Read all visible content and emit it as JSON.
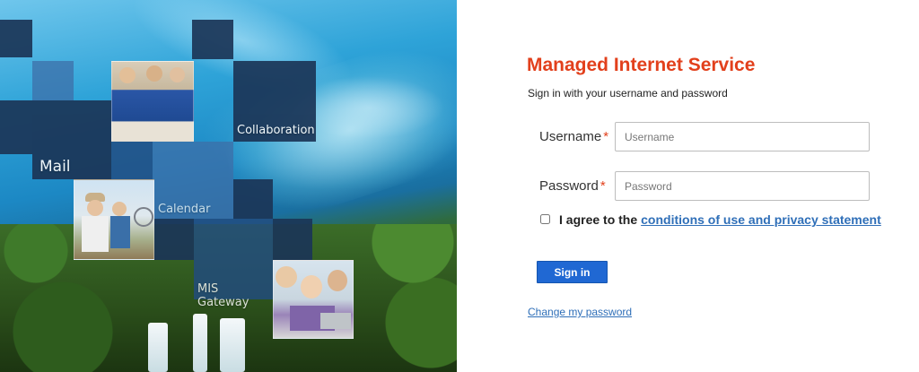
{
  "hero": {
    "tiles": {
      "collaboration": "Collaboration",
      "mail": "Mail",
      "calendar": "Calendar",
      "mis_gateway": "MIS Gateway"
    }
  },
  "login": {
    "title": "Managed Internet Service",
    "subtitle": "Sign in with your username and password",
    "username_label": "Username",
    "username_placeholder": "Username",
    "password_label": "Password",
    "password_placeholder": "Password",
    "required_marker": "*",
    "agree_prefix": "I agree to the",
    "agree_link": "conditions of use and privacy statement",
    "signin_label": "Sign in",
    "change_password": "Change my password"
  },
  "colors": {
    "title": "#e2401c",
    "button": "#2068d3",
    "link": "#2f6fb8"
  }
}
